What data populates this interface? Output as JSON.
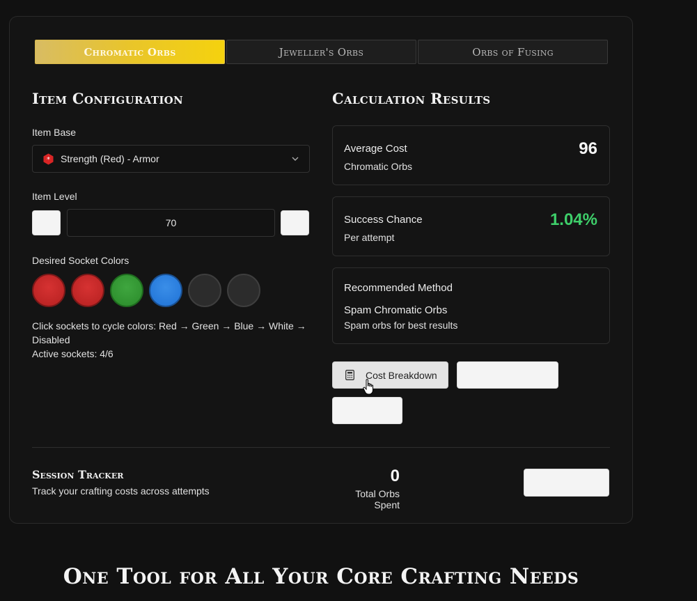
{
  "tabs": [
    {
      "label": "Chromatic Orbs",
      "active": true
    },
    {
      "label": "Jeweller's Orbs",
      "active": false
    },
    {
      "label": "Orbs of Fusing",
      "active": false
    }
  ],
  "config": {
    "title": "Item Configuration",
    "item_base_label": "Item Base",
    "item_base_value": "Strength (Red) - Armor",
    "item_level_label": "Item Level",
    "item_level_value": "70",
    "socket_label": "Desired Socket Colors",
    "sockets": [
      "red",
      "red",
      "green",
      "blue",
      "disabled",
      "disabled"
    ],
    "help_text": "Click sockets to cycle colors: Red → Green → Blue → White → Disabled",
    "active_sockets": "Active sockets: 4/6"
  },
  "results": {
    "title": "Calculation Results",
    "average_cost_label": "Average Cost",
    "average_cost_value": "96",
    "average_cost_unit": "Chromatic Orbs",
    "success_label": "Success Chance",
    "success_value": "1.04%",
    "success_sub": "Per attempt",
    "success_color": "#3ecf6a",
    "recommended_label": "Recommended Method",
    "recommended_method": "Spam Chromatic Orbs",
    "recommended_sub": "Spam orbs for best results",
    "cost_breakdown_label": "Cost Breakdown"
  },
  "session": {
    "title": "Session Tracker",
    "subtitle": "Track your crafting costs across attempts",
    "total_value": "0",
    "total_label": "Total Orbs Spent"
  },
  "footer": {
    "heading": "One Tool for All Your Core Crafting Needs"
  },
  "colors": {
    "accent_gold": "#f5d20e",
    "background": "#111111"
  }
}
